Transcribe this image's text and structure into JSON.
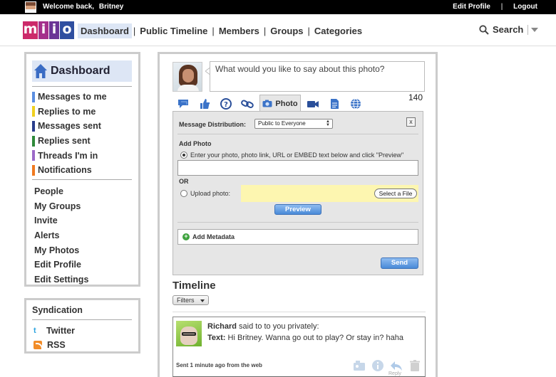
{
  "topbar": {
    "welcome": "Welcome back,",
    "user": "Britney",
    "edit_profile": "Edit Profile",
    "separator": "|",
    "logout": "Logout"
  },
  "header": {
    "logo_letters": [
      "m",
      "i",
      "i",
      "o"
    ],
    "nav": [
      "Dashboard",
      "Public Timeline",
      "Members",
      "Groups",
      "Categories"
    ],
    "nav_separator": "|",
    "active_nav": "Dashboard",
    "search_label": "Search"
  },
  "sidebar": {
    "title": "Dashboard",
    "message_items": [
      {
        "label": "Messages to me",
        "color": "#5b8ee0"
      },
      {
        "label": "Replies to me",
        "color": "#f0d020"
      },
      {
        "label": "Messages sent",
        "color": "#2a3e8c"
      },
      {
        "label": "Replies sent",
        "color": "#2f8a3a"
      },
      {
        "label": "Threads I'm in",
        "color": "#9c6ac8"
      },
      {
        "label": "Notifications",
        "color": "#f07a20"
      }
    ],
    "links": [
      "People",
      "My Groups",
      "Invite",
      "Alerts",
      "My Photos",
      "Edit Profile",
      "Edit Settings"
    ],
    "syndication": {
      "title": "Syndication",
      "twitter": "Twitter",
      "rss": "RSS"
    }
  },
  "composer": {
    "placeholder": "What would you like to say about this photo?",
    "counter": "140",
    "tabs": [
      {
        "icon": "speech-bubble-icon"
      },
      {
        "icon": "thumbs-up-icon"
      },
      {
        "icon": "question-icon"
      },
      {
        "icon": "link-icon"
      },
      {
        "icon": "camera-icon",
        "label": "Photo",
        "active": true
      },
      {
        "icon": "video-camera-icon"
      },
      {
        "icon": "document-icon"
      },
      {
        "icon": "globe-icon"
      }
    ],
    "panel": {
      "distribution_label": "Message Distribution:",
      "distribution_value": "Public to Everyone",
      "close": "x",
      "add_photo": "Add Photo",
      "option_embed": "Enter your photo, photo link, URL or EMBED text below and click \"Preview\"",
      "or": "OR",
      "upload_label": "Upload photo:",
      "select_file": "Select a File",
      "preview": "Preview",
      "add_metadata": "Add Metadata",
      "send": "Send"
    }
  },
  "timeline": {
    "title": "Timeline",
    "filters": "Filters",
    "entries": [
      {
        "author": "Richard",
        "context": "said to to you privately:",
        "text_label": "Text:",
        "text": "Hi Britney. Wanna go out to play? Or stay in? haha",
        "sent": "Sent 1 minute ago from the web",
        "reply_label": "Reply"
      }
    ]
  },
  "colors": {
    "accent": "#dde6f5",
    "topbar": "#000000",
    "upload_highlight": "#fdf6b0",
    "button_blue": "#4a8ad8"
  }
}
